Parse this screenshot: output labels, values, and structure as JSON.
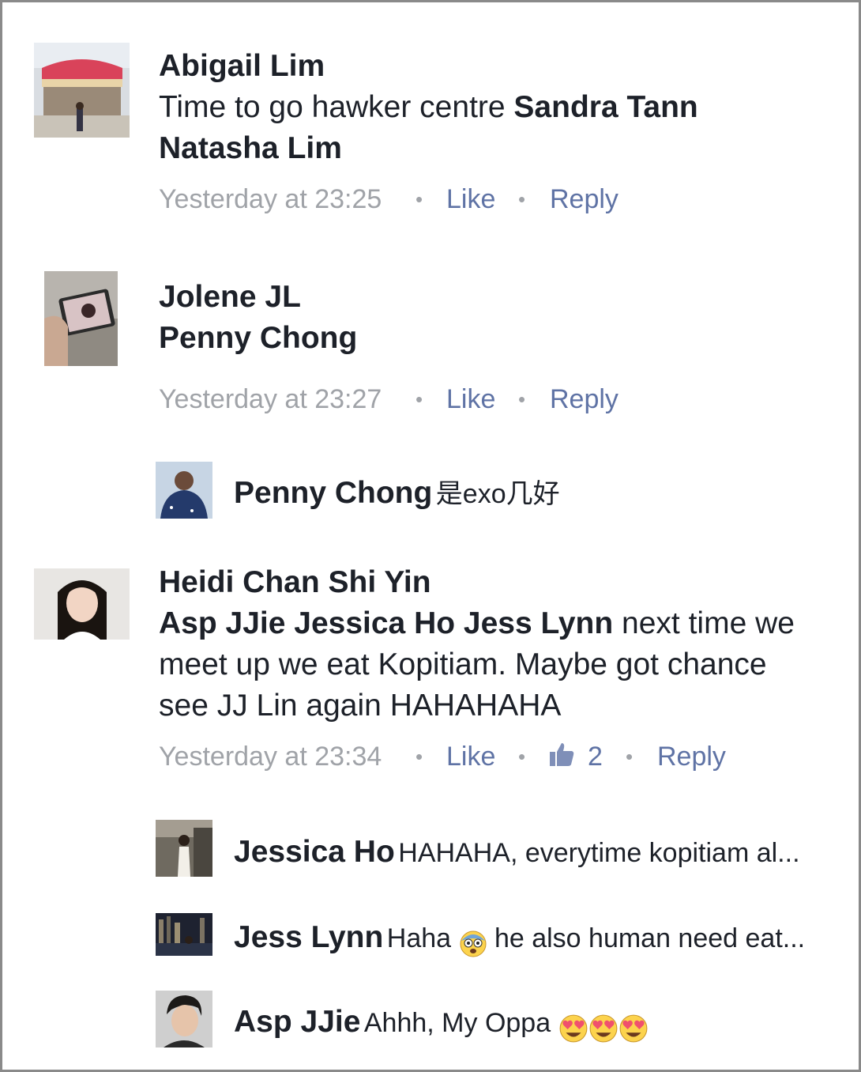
{
  "comments": [
    {
      "name": "Abigail Lim",
      "text_prefix": "Time to go hawker centre ",
      "tag1": "Sandra Tann",
      "tag2": "Natasha Lim",
      "time": "Yesterday at 23:25",
      "like": "Like",
      "reply": "Reply"
    },
    {
      "name": "Jolene JL",
      "tag1": "Penny Chong",
      "time": "Yesterday at 23:27",
      "like": "Like",
      "reply": "Reply"
    },
    {
      "name": "Heidi Chan Shi Yin",
      "tags": "Asp JJie Jessica Ho Jess Lynn",
      "text_line1": " next time we",
      "text_line2": "meet up we eat Kopitiam. Maybe got chance",
      "text_line3": "see JJ Lin again HAHAHAHA",
      "time": "Yesterday at 23:34",
      "like": "Like",
      "like_count": "2",
      "reply": "Reply"
    }
  ],
  "replies": [
    {
      "name": "Penny Chong",
      "text": "是exo几好"
    },
    {
      "name": "Jessica Ho",
      "text": "HAHAHA, everytime kopitiam al..."
    },
    {
      "name": "Jess Lynn",
      "text_before": "Haha ",
      "text_after": " he also human need eat..."
    },
    {
      "name": "Asp JJie",
      "text": "Ahhh, My Oppa "
    }
  ],
  "separator": "•",
  "icons": {
    "shocked_emoji": "fearful-face-emoji",
    "heart_eyes_emoji": "heart-eyes-emoji",
    "thumb": "thumbs-up-icon"
  },
  "colors": {
    "name": "#1d2129",
    "meta_gray": "#a0a3a8",
    "link_blue": "#5f73a5",
    "border": "#8a8a8a"
  }
}
